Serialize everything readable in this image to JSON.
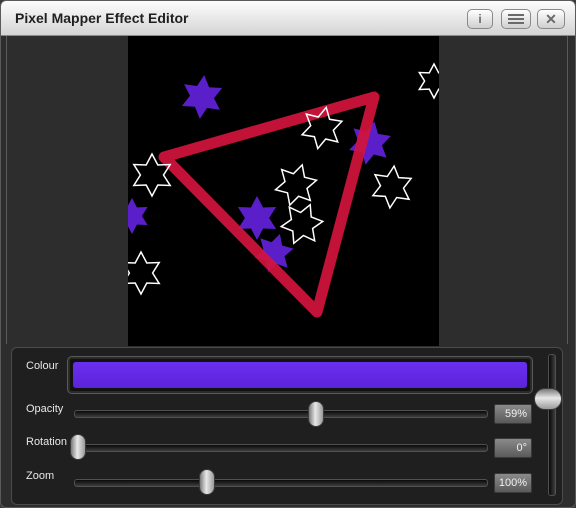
{
  "window": {
    "title": "Pixel Mapper Effect Editor"
  },
  "title_buttons": {
    "info_label": "i",
    "menu_icon": "hamburger-menu-icon",
    "close_label": "✕"
  },
  "preview": {
    "background": "#000000",
    "star_outline_color": "#ffffff",
    "star_fill_color": "#5a1fc8",
    "triangle_color": "#d2143c"
  },
  "controls": {
    "colour": {
      "label": "Colour",
      "value": "#6a2ff0"
    },
    "opacity": {
      "label": "Opacity",
      "value_text": "59%",
      "level": 0.59
    },
    "rotation": {
      "label": "Rotation",
      "value_text": "0°",
      "level": 0.0
    },
    "zoom": {
      "label": "Zoom",
      "value_text": "100%",
      "level": 0.32
    }
  }
}
